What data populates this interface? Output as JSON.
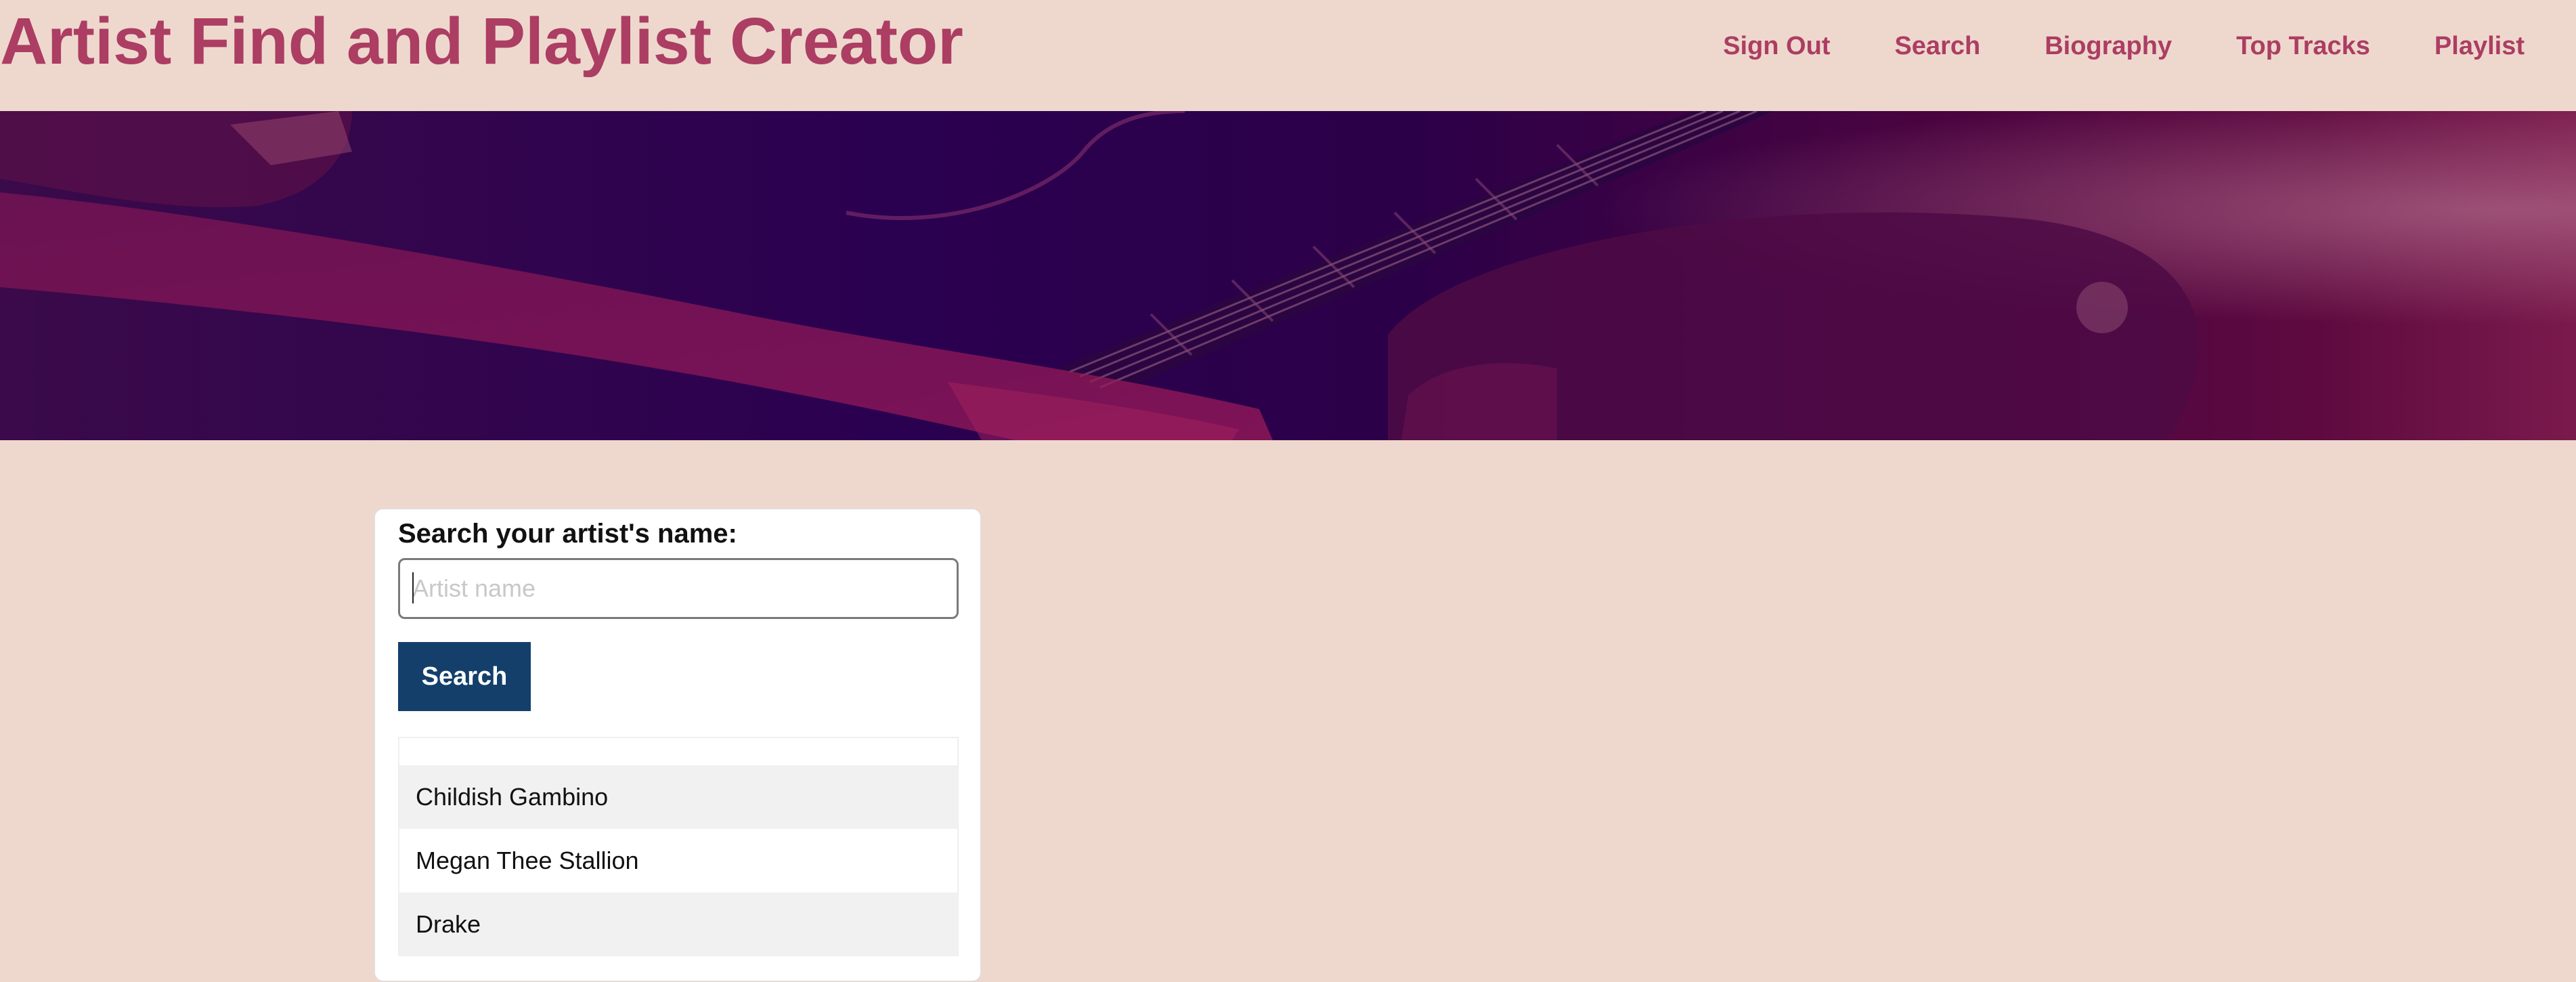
{
  "header": {
    "title": "Artist Find and Playlist Creator",
    "nav": [
      {
        "label": "Sign Out"
      },
      {
        "label": "Search"
      },
      {
        "label": "Biography"
      },
      {
        "label": "Top Tracks"
      },
      {
        "label": "Playlist"
      }
    ]
  },
  "hero": {
    "image": "guitar-player-photo"
  },
  "search": {
    "label": "Search your artist's name:",
    "input_value": "",
    "placeholder": "Artist name",
    "button_label": "Search"
  },
  "results": [
    {
      "name": "Childish Gambino"
    },
    {
      "name": "Megan Thee Stallion"
    },
    {
      "name": "Drake"
    }
  ],
  "colors": {
    "background": "#eed8cd",
    "accent": "#ac3d63",
    "button": "#143f6b"
  }
}
